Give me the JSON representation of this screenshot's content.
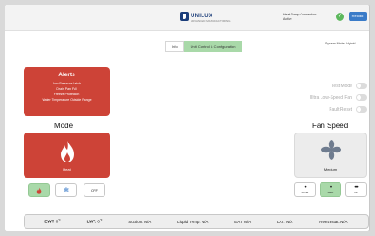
{
  "header": {
    "brand_name": "UNILUX",
    "brand_tagline": "ADVANCED MANUFACTURING",
    "connection_label": "Heat Pump Connection:",
    "connection_status": "Active",
    "reload_label": "Reload"
  },
  "tabs": [
    {
      "label": "Info",
      "active": false
    },
    {
      "label": "Unit Control & Configuration",
      "active": true
    }
  ],
  "system_mode": "System Mode: Hybrid",
  "alerts": {
    "title": "Alerts",
    "items": [
      "Low Pressure Latch",
      "Drain Pan Full",
      "Freeze Protection",
      "Water Temperature Outside Range"
    ]
  },
  "toggles": [
    {
      "label": "Test Mode",
      "on": false
    },
    {
      "label": "Ultra Low-Speed Fan",
      "on": false
    },
    {
      "label": "Fault Reset",
      "on": false
    }
  ],
  "mode": {
    "title": "Mode",
    "current": "Heat",
    "buttons": [
      {
        "icon": "flame-icon",
        "label": "",
        "active": true
      },
      {
        "icon": "snowflake-icon",
        "label": "",
        "active": false
      },
      {
        "icon": "",
        "label": "OFF",
        "active": false
      }
    ]
  },
  "fan": {
    "title": "Fan Speed",
    "current": "Medium",
    "buttons": [
      {
        "dots": "•",
        "label": "LOW",
        "active": false
      },
      {
        "dots": "••",
        "label": "MED",
        "active": true
      },
      {
        "dots": "•••",
        "label": "HI",
        "active": false
      }
    ]
  },
  "status_bar": {
    "ewt_label": "EWT:",
    "ewt_value": "0",
    "ewt_unit": "°F",
    "lwt_label": "LWT:",
    "lwt_value": "0",
    "lwt_unit": "°F",
    "suction": "Suction: N/A",
    "liquid_temp": "Liquid Temp: N/A",
    "eat": "EAT: N/A",
    "lat": "LAT: N/A",
    "freezestat": "Freezestat: N/A"
  },
  "colors": {
    "alert_red": "#cd4337",
    "active_green": "#a9d9a9",
    "brand_blue": "#1b3d7a",
    "reload_blue": "#3a7bc8",
    "status_green": "#5cb85c"
  }
}
